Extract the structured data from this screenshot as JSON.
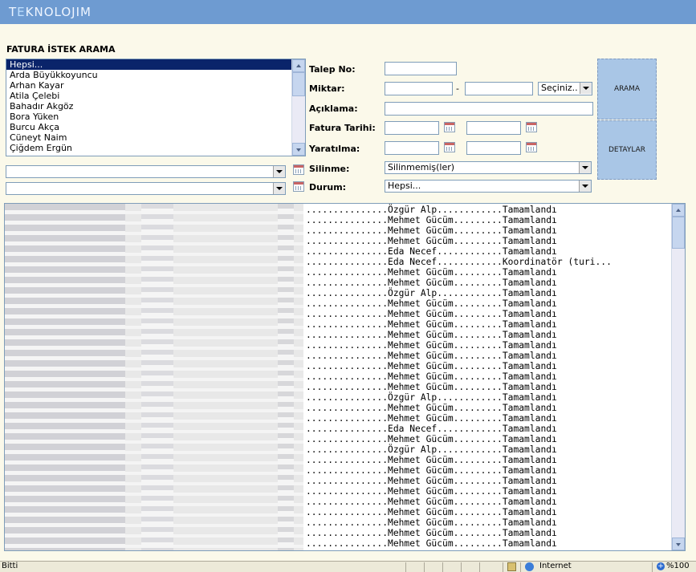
{
  "header": {
    "logo_prefix": "T",
    "logo_e": "E",
    "logo_rest": "KNOLOJIM"
  },
  "page_title": "FATURA İSTEK ARAMA",
  "person_list": [
    "Hepsi...",
    "Arda Büyükkoyuncu",
    "Arhan Kayar",
    "Atila Çelebi",
    "Bahadır Akgöz",
    "Bora Yüken",
    "Burcu Akça",
    "Cüneyt Naim",
    "Çiğdem Ergün"
  ],
  "form": {
    "talep_no_label": "Talep No:",
    "miktar_label": "Miktar:",
    "miktar_dash": "-",
    "miktar_unit": "Seçiniz..",
    "aciklama_label": "Açıklama:",
    "fatura_tarihi_label": "Fatura Tarihi:",
    "yaratilma_label": "Yaratılma:",
    "silinme_label": "Silinme:",
    "silinme_value": "Silinmemiş(ler)",
    "durum_label": "Durum:",
    "durum_value": "Hepsi...",
    "left_select_1": "",
    "left_select_2": ""
  },
  "buttons": {
    "search": "ARAMA",
    "details": "DETAYLAR"
  },
  "results": [
    "...............Özgür Alp............Tamamlandı",
    "...............Mehmet Gücüm.........Tamamlandı",
    "...............Mehmet Gücüm.........Tamamlandı",
    "...............Mehmet Gücüm.........Tamamlandı",
    "...............Eda Necef............Tamamlandı",
    "...............Eda Necef............Koordinatör (turi...",
    "...............Mehmet Gücüm.........Tamamlandı",
    "...............Mehmet Gücüm.........Tamamlandı",
    "...............Özgür Alp............Tamamlandı",
    "...............Mehmet Gücüm.........Tamamlandı",
    "...............Mehmet Gücüm.........Tamamlandı",
    "...............Mehmet Gücüm.........Tamamlandı",
    "...............Mehmet Gücüm.........Tamamlandı",
    "...............Mehmet Gücüm.........Tamamlandı",
    "...............Mehmet Gücüm.........Tamamlandı",
    "...............Mehmet Gücüm.........Tamamlandı",
    "...............Mehmet Gücüm.........Tamamlandı",
    "...............Mehmet Gücüm.........Tamamlandı",
    "...............Özgür Alp............Tamamlandı",
    "...............Mehmet Gücüm.........Tamamlandı",
    "...............Mehmet Gücüm.........Tamamlandı",
    "...............Eda Necef............Tamamlandı",
    "...............Mehmet Gücüm.........Tamamlandı",
    "...............Özgür Alp............Tamamlandı",
    "...............Mehmet Gücüm.........Tamamlandı",
    "...............Mehmet Gücüm.........Tamamlandı",
    "...............Mehmet Gücüm.........Tamamlandı",
    "...............Mehmet Gücüm.........Tamamlandı",
    "...............Mehmet Gücüm.........Tamamlandı",
    "...............Mehmet Gücüm.........Tamamlandı",
    "...............Mehmet Gücüm.........Tamamlandı",
    "...............Mehmet Gücüm.........Tamamlandı",
    "...............Mehmet Gücüm.........Tamamlandı"
  ],
  "status": {
    "text": "Bitti",
    "zone": "Internet",
    "zoom": "%100"
  }
}
